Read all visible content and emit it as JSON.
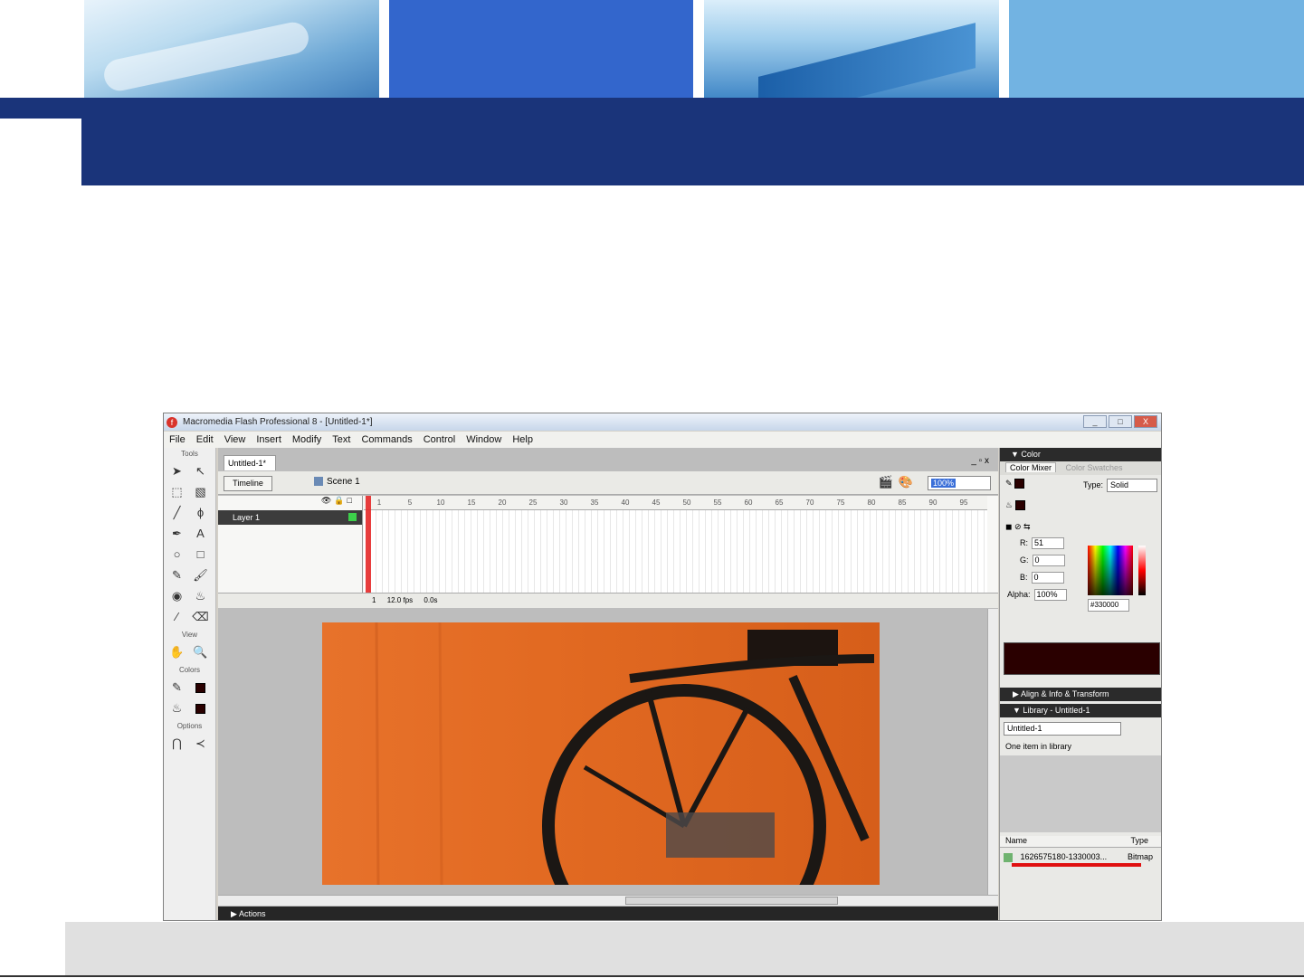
{
  "window": {
    "title": "Macromedia Flash Professional 8 - [Untitled-1*]",
    "buttons": [
      "_",
      "□",
      "X"
    ]
  },
  "menu": [
    "File",
    "Edit",
    "View",
    "Insert",
    "Modify",
    "Text",
    "Commands",
    "Control",
    "Window",
    "Help"
  ],
  "tools": {
    "label_tools": "Tools",
    "label_view": "View",
    "label_colors": "Colors",
    "label_options": "Options"
  },
  "document": {
    "tab": "Untitled-1*",
    "controls": "_ ▫ x",
    "timeline_button": "Timeline",
    "scene": "Scene 1",
    "zoom": "100%",
    "layer_name": "Layer 1",
    "ruler": [
      "1",
      "5",
      "10",
      "15",
      "20",
      "25",
      "30",
      "35",
      "40",
      "45",
      "50",
      "55",
      "60",
      "65",
      "70",
      "75",
      "80",
      "85",
      "90",
      "95"
    ],
    "status": {
      "frame": "1",
      "fps": "12.0 fps",
      "time": "0.0s"
    },
    "actions": "Actions"
  },
  "color_panel": {
    "title": "Color",
    "tab_mixer": "Color Mixer",
    "tab_swatches": "Color Swatches",
    "type_label": "Type:",
    "type_value": "Solid",
    "r_label": "R:",
    "r_value": "51",
    "g_label": "G:",
    "g_value": "0",
    "b_label": "B:",
    "b_value": "0",
    "alpha_label": "Alpha:",
    "alpha_value": "100%",
    "hex": "#330000",
    "current_color": "#2a0000"
  },
  "align_panel": {
    "title": "Align & Info & Transform"
  },
  "library": {
    "title": "Library - Untitled-1",
    "doc_select": "Untitled-1",
    "count": "One item in library",
    "col_name": "Name",
    "col_type": "Type",
    "item_name": "1626575180-1330003...",
    "item_type": "Bitmap"
  }
}
